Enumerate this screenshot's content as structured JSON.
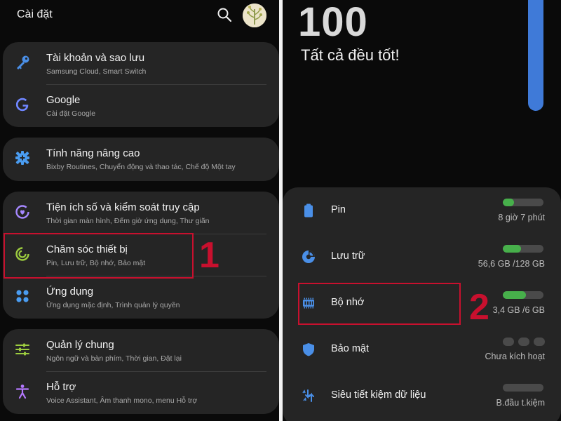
{
  "left": {
    "header": {
      "title": "Cài đặt",
      "search_icon": "search-icon",
      "avatar_icon": "avatar"
    },
    "groups": [
      [
        {
          "icon": "key-icon",
          "title": "Tài khoản và sao lưu",
          "subtitle": "Samsung Cloud, Smart Switch",
          "color": "#4a8fe7"
        },
        {
          "icon": "google-icon",
          "title": "Google",
          "subtitle": "Cài đặt Google",
          "color": "#6f86ff"
        }
      ],
      [
        {
          "icon": "gear-plus-icon",
          "title": "Tính năng nâng cao",
          "subtitle": "Bixby Routines, Chuyển động và thao tác, Chế độ Một tay",
          "color": "#4a9cf0"
        }
      ],
      [
        {
          "icon": "digital-wellbeing-icon",
          "title": "Tiện ích số và kiểm soát truy cập",
          "subtitle": "Thời gian màn hình, Đếm giờ ứng dụng, Thư giãn",
          "color": "#a688ff"
        },
        {
          "icon": "device-care-icon",
          "title": "Chăm sóc thiết bị",
          "subtitle": "Pin, Lưu trữ, Bộ nhớ, Bảo mật",
          "color": "#9ccc3f"
        },
        {
          "icon": "apps-icon",
          "title": "Ứng dụng",
          "subtitle": "Ứng dụng mặc định, Trình quản lý quyền",
          "color": "#4a9cf0"
        }
      ],
      [
        {
          "icon": "sliders-icon",
          "title": "Quản lý chung",
          "subtitle": "Ngôn ngữ và bàn phím, Thời gian, Đặt lại",
          "color": "#9ccc3f"
        },
        {
          "icon": "accessibility-icon",
          "title": "Hỗ trợ",
          "subtitle": "Voice Assistant, Âm thanh mono, menu Hỗ trợ",
          "color": "#b478ff"
        }
      ]
    ],
    "annotation": "1"
  },
  "right": {
    "score": "100",
    "status": "Tất cả đều tốt!",
    "items": [
      {
        "icon": "battery-icon",
        "title": "Pin",
        "value": "8 giờ 7 phút",
        "level": 0.28,
        "color": "#4a8fe7"
      },
      {
        "icon": "storage-icon",
        "title": "Lưu trữ",
        "value": "56,6 GB /128 GB",
        "level": 0.45,
        "color": "#4a8fe7"
      },
      {
        "icon": "memory-icon",
        "title": "Bộ nhớ",
        "value": "3,4 GB /6 GB",
        "level": 0.57,
        "color": "#4a8fe7"
      },
      {
        "icon": "shield-icon",
        "title": "Bảo mật",
        "value": "Chưa kích hoạt",
        "color": "#4a8fe7"
      },
      {
        "icon": "data-saver-icon",
        "title": "Siêu tiết kiệm dữ liệu",
        "value": "B.đầu t.kiệm",
        "level": 0,
        "color": "#4a8fe7"
      }
    ],
    "annotation": "2"
  }
}
